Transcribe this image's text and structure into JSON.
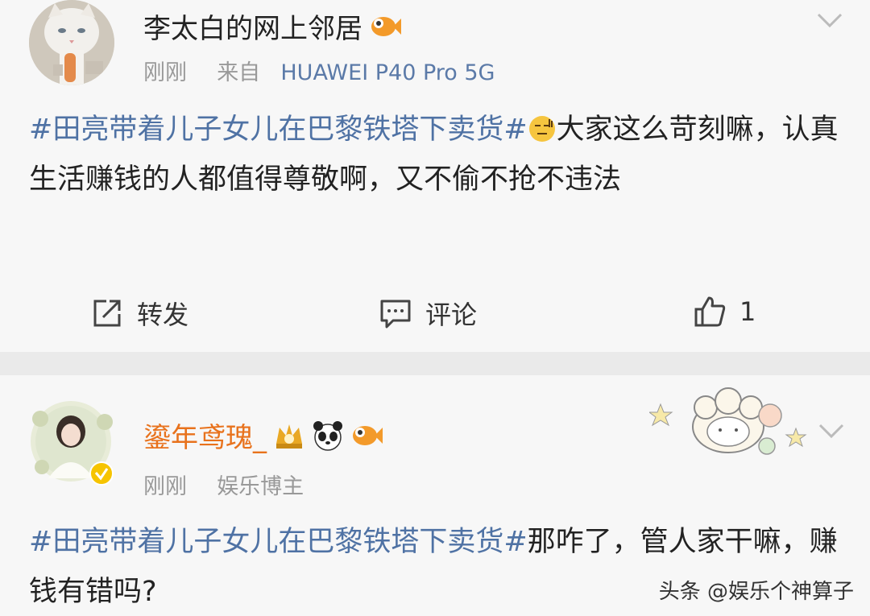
{
  "post1": {
    "username": "李太白的网上邻居",
    "time": "刚刚",
    "source_prefix": "来自",
    "device": "HUAWEI P40 Pro 5G",
    "topic": "#田亮带着儿子女儿在巴黎铁塔下卖货#",
    "body": "大家这么苛刻嘛，认真生活赚钱的人都值得尊敬啊，又不偷不抢不违法",
    "actions": {
      "repost": "转发",
      "comment": "评论",
      "like_count": "1"
    },
    "colors": {
      "topic": "#4f72a4",
      "device": "#5b7aa8"
    }
  },
  "post2": {
    "username": "鎏年鸢瑰_",
    "time": "刚刚",
    "role": "娱乐博主",
    "topic": "#田亮带着儿子女儿在巴黎铁塔下卖货#",
    "body": "那咋了，管人家干嘛，赚钱有错吗?",
    "colors": {
      "username": "#e8721c"
    }
  },
  "watermark": "头条 @娱乐个神算子",
  "icons": [
    "cat-avatar-icon",
    "fish-badge-icon",
    "chevron-down-icon",
    "wry-face-emoji-icon",
    "repost-icon",
    "comment-icon",
    "like-icon",
    "crown-badge-icon",
    "panda-badge-icon",
    "verified-badge-icon"
  ]
}
